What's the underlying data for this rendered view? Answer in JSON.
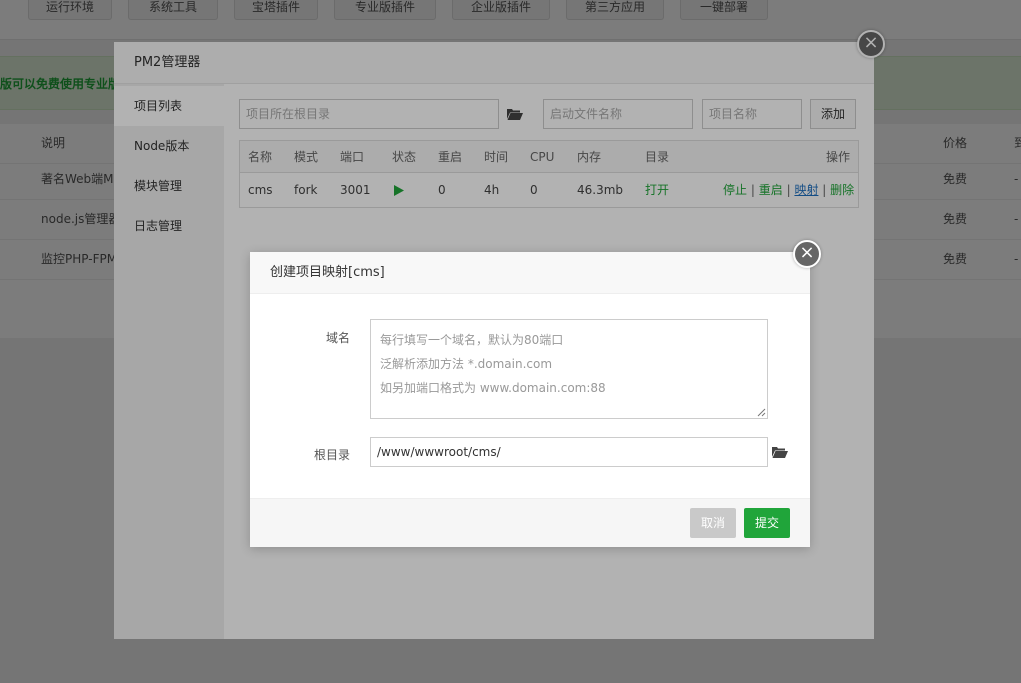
{
  "top_tabs": [
    "运行环境",
    "系统工具",
    "宝塔插件",
    "专业版插件",
    "企业版插件",
    "第三方应用",
    "一键部署"
  ],
  "banner_text": "版可以免费使用专业版",
  "bg_table": {
    "col_desc": "说明",
    "col_price": "价格",
    "col_more": "到",
    "rows": [
      {
        "desc": "著名Web端M",
        "price": "免费",
        "more": "-"
      },
      {
        "desc": "node.js管理器",
        "price": "免费",
        "more": "-"
      },
      {
        "desc": "监控PHP-FPM",
        "price": "免费",
        "more": "-"
      }
    ]
  },
  "pm2": {
    "title": "PM2管理器",
    "sidebar": [
      "项目列表",
      "Node版本",
      "模块管理",
      "日志管理"
    ],
    "inputs": {
      "root_placeholder": "项目所在根目录",
      "start_placeholder": "启动文件名称",
      "name_placeholder": "项目名称",
      "add_label": "添加"
    },
    "table": {
      "headers": [
        "名称",
        "模式",
        "端口",
        "状态",
        "重启",
        "时间",
        "CPU",
        "内存",
        "目录",
        "操作"
      ],
      "row": {
        "name": "cms",
        "mode": "fork",
        "port": "3001",
        "status_icon": "play-icon",
        "restart": "0",
        "time": "4h",
        "cpu": "0",
        "memory": "46.3mb",
        "dir": "打开",
        "ops": [
          "停止",
          "重启",
          "映射",
          "删除"
        ]
      }
    }
  },
  "dialog": {
    "title": "创建项目映射[cms]",
    "domain_label": "域名",
    "domain_placeholder_lines": [
      "每行填写一个域名，默认为80端口",
      "泛解析添加方法 *.domain.com",
      "如另加端口格式为 www.domain.com:88"
    ],
    "root_label": "根目录",
    "root_value": "/www/wwwroot/cms/",
    "cancel_label": "取消",
    "submit_label": "提交"
  },
  "colors": {
    "accent": "#20a53a",
    "link_blue": "#1e6fbf"
  }
}
